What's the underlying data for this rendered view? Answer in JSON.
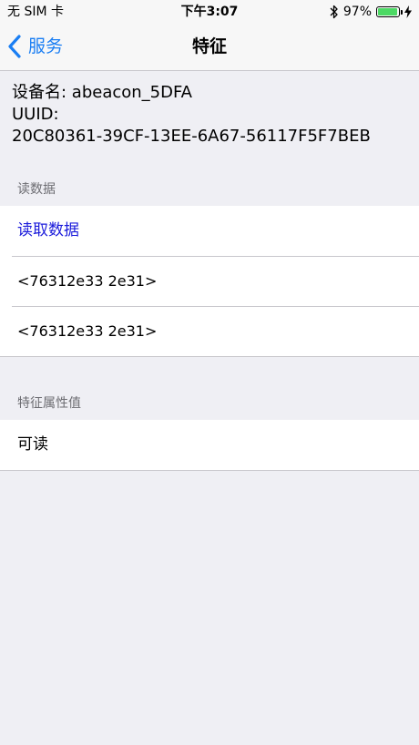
{
  "status_bar": {
    "carrier": "无 SIM 卡",
    "time": "下午3:07",
    "battery_percent": "97%",
    "battery_level": 0.97,
    "icons": [
      "bluetooth-icon",
      "battery-icon",
      "charging-icon"
    ],
    "battery_color": "#4cd964"
  },
  "nav": {
    "back_label": "服务",
    "title": "特征",
    "accent_color": "#1a7ef3"
  },
  "device": {
    "name_line": "设备名: abeacon_5DFA",
    "uuid_label": "UUID:",
    "uuid_value": "20C80361-39CF-13EE-6A67-56117F5F7BEB"
  },
  "sections": {
    "read": {
      "header": "读数据",
      "action_label": "读取数据",
      "values": [
        "<76312e33 2e31>",
        "<76312e33 2e31>"
      ]
    },
    "properties": {
      "header": "特征属性值",
      "items": [
        "可读"
      ]
    }
  }
}
